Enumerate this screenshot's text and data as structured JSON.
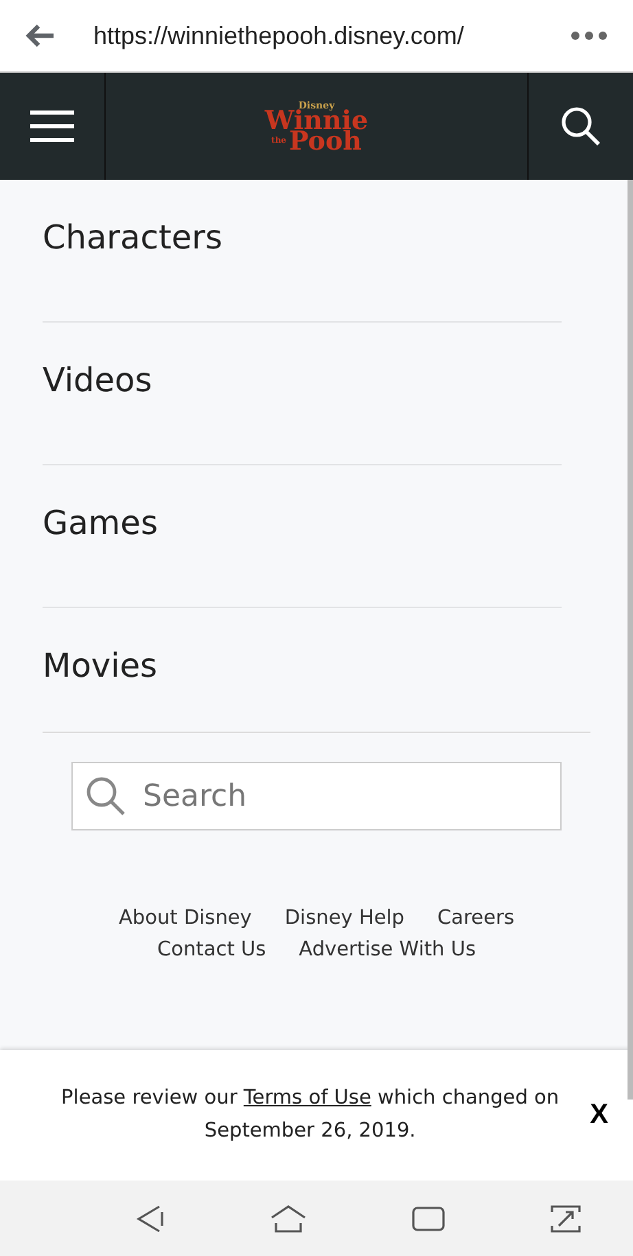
{
  "browser": {
    "url": "https://winniethepooh.disney.com/"
  },
  "header": {
    "logo": {
      "brand": "Disney",
      "line1": "Winnie",
      "line2": "the",
      "line3": "Pooh"
    }
  },
  "menu": [
    {
      "label": "Characters"
    },
    {
      "label": "Videos"
    },
    {
      "label": "Games"
    },
    {
      "label": "Movies"
    }
  ],
  "search": {
    "placeholder": "Search"
  },
  "footer_links": [
    [
      "About Disney",
      "Disney Help",
      "Careers"
    ],
    [
      "Contact Us",
      "Advertise With Us"
    ]
  ],
  "notice": {
    "before": "Please review our ",
    "link": "Terms of Use",
    "after": " which changed on September 26, 2019.",
    "close": "X"
  }
}
